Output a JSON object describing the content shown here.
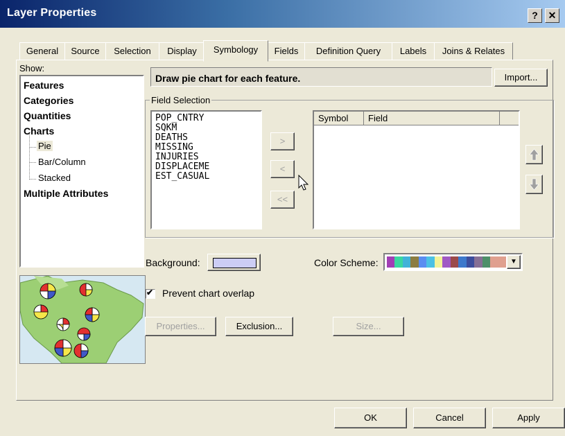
{
  "window": {
    "title": "Layer Properties",
    "help_label": "?",
    "close_label": "✕"
  },
  "tabs": [
    {
      "label": "General"
    },
    {
      "label": "Source"
    },
    {
      "label": "Selection"
    },
    {
      "label": "Display"
    },
    {
      "label": "Symbology"
    },
    {
      "label": "Fields"
    },
    {
      "label": "Definition Query"
    },
    {
      "label": "Labels"
    },
    {
      "label": "Joins & Relates"
    }
  ],
  "active_tab": "Symbology",
  "show": {
    "label": "Show:",
    "items": [
      {
        "label": "Features"
      },
      {
        "label": "Categories"
      },
      {
        "label": "Quantities"
      },
      {
        "label": "Charts"
      },
      {
        "label": "Pie"
      },
      {
        "label": "Bar/Column"
      },
      {
        "label": "Stacked"
      },
      {
        "label": "Multiple Attributes"
      }
    ],
    "selected": "Pie"
  },
  "description": "Draw pie chart for each feature.",
  "import_label": "Import...",
  "field_selection": {
    "legend": "Field Selection",
    "available_fields": [
      "POP_CNTRY",
      "SQKM",
      "DEATHS",
      "MISSING",
      "INJURIES",
      "DISPLACEME",
      "EST_CASUAL"
    ],
    "add_label": ">",
    "remove_label": "<",
    "remove_all_label": "<<",
    "columns": {
      "symbol": "Symbol",
      "field": "Field"
    }
  },
  "background": {
    "label": "Background:",
    "color": "#cccdf5"
  },
  "color_scheme": {
    "label": "Color Scheme:",
    "colors": [
      "#a23eb5",
      "#3ad7a0",
      "#41b2d8",
      "#8c7d41",
      "#5a8df1",
      "#4cc1e4",
      "#f2f29a",
      "#a059c4",
      "#9b4a4a",
      "#3d79cc",
      "#3d4d9c",
      "#866f95",
      "#4d8f69",
      "#e0a08f",
      "#e0a08f"
    ]
  },
  "prevent_overlap": {
    "label": "Prevent chart overlap",
    "checked": true
  },
  "buttons": {
    "properties": "Properties...",
    "exclusion": "Exclusion...",
    "size": "Size..."
  },
  "footer": {
    "ok": "OK",
    "cancel": "Cancel",
    "apply": "Apply"
  },
  "colors": {
    "accent": "#0a246a",
    "face": "#ece9d8",
    "map_land": "#9ccf74",
    "map_water": "#d6e8f2"
  }
}
